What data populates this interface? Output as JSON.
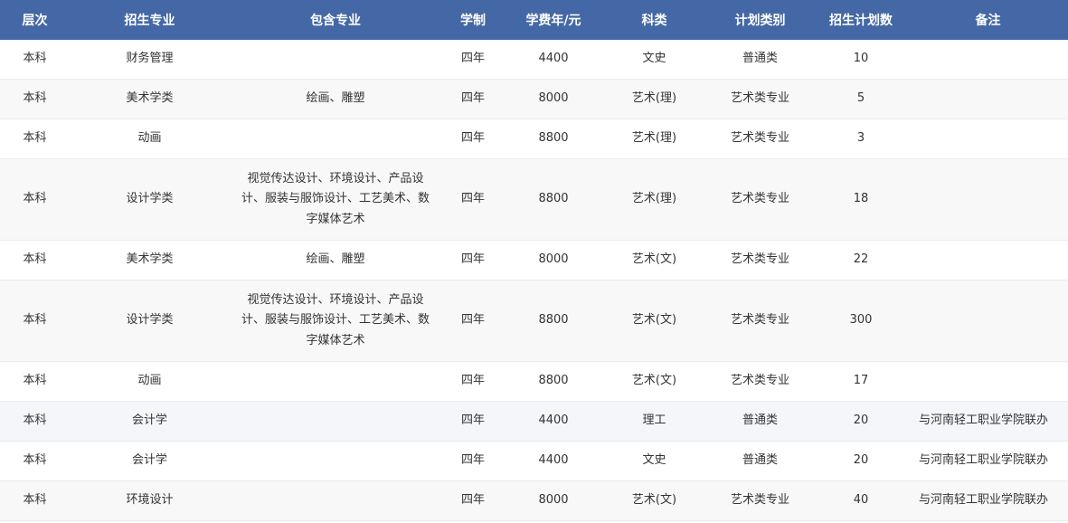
{
  "headers": [
    "层次",
    "招生专业",
    "包含专业",
    "学制",
    "学费年/元",
    "科类",
    "计划类别",
    "招生计划数",
    "备注"
  ],
  "rows": [
    {
      "level": "本科",
      "major": "财务管理",
      "included": "",
      "duration": "四年",
      "tuition": "4400",
      "category": "文史",
      "plan_type": "普通类",
      "count": "10",
      "remark": ""
    },
    {
      "level": "本科",
      "major": "美术学类",
      "included": "绘画、雕塑",
      "duration": "四年",
      "tuition": "8000",
      "category": "艺术(理)",
      "plan_type": "艺术类专业",
      "count": "5",
      "remark": ""
    },
    {
      "level": "本科",
      "major": "动画",
      "included": "",
      "duration": "四年",
      "tuition": "8800",
      "category": "艺术(理)",
      "plan_type": "艺术类专业",
      "count": "3",
      "remark": ""
    },
    {
      "level": "本科",
      "major": "设计学类",
      "included": "视觉传达设计、环境设计、产品设计、服装与服饰设计、工艺美术、数字媒体艺术",
      "duration": "四年",
      "tuition": "8800",
      "category": "艺术(理)",
      "plan_type": "艺术类专业",
      "count": "18",
      "remark": ""
    },
    {
      "level": "本科",
      "major": "美术学类",
      "included": "绘画、雕塑",
      "duration": "四年",
      "tuition": "8000",
      "category": "艺术(文)",
      "plan_type": "艺术类专业",
      "count": "22",
      "remark": ""
    },
    {
      "level": "本科",
      "major": "设计学类",
      "included": "视觉传达设计、环境设计、产品设计、服装与服饰设计、工艺美术、数字媒体艺术",
      "duration": "四年",
      "tuition": "8800",
      "category": "艺术(文)",
      "plan_type": "艺术类专业",
      "count": "300",
      "remark": ""
    },
    {
      "level": "本科",
      "major": "动画",
      "included": "",
      "duration": "四年",
      "tuition": "8800",
      "category": "艺术(文)",
      "plan_type": "艺术类专业",
      "count": "17",
      "remark": ""
    },
    {
      "level": "本科",
      "major": "会计学",
      "included": "",
      "duration": "四年",
      "tuition": "4400",
      "category": "理工",
      "plan_type": "普通类",
      "count": "20",
      "remark": "与河南轻工职业学院联办"
    },
    {
      "level": "本科",
      "major": "会计学",
      "included": "",
      "duration": "四年",
      "tuition": "4400",
      "category": "文史",
      "plan_type": "普通类",
      "count": "20",
      "remark": "与河南轻工职业学院联办"
    },
    {
      "level": "本科",
      "major": "环境设计",
      "included": "",
      "duration": "四年",
      "tuition": "8000",
      "category": "艺术(文)",
      "plan_type": "艺术类专业",
      "count": "40",
      "remark": "与河南轻工职业学院联办"
    }
  ]
}
